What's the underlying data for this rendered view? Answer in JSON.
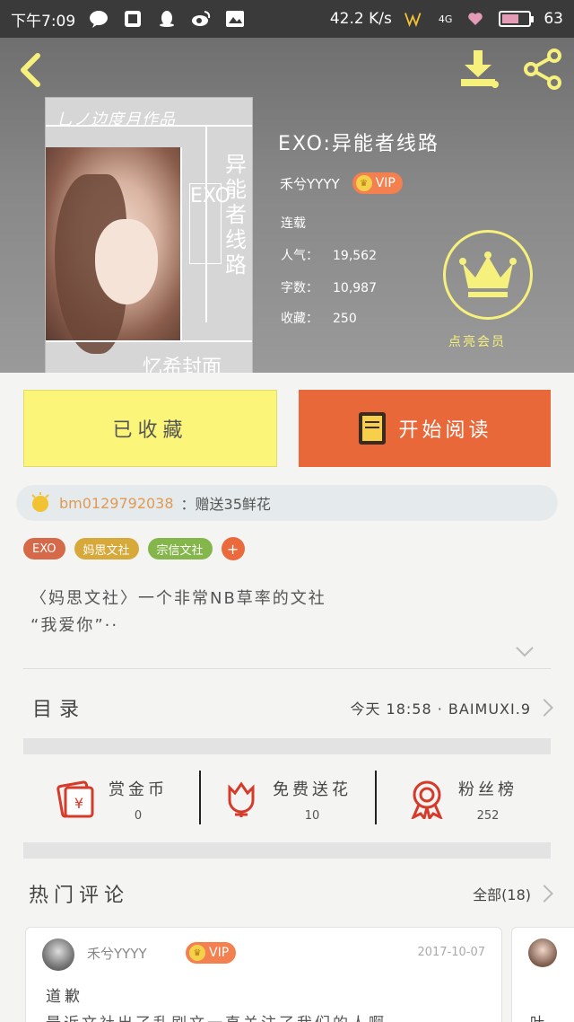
{
  "status_bar": {
    "time": "下午7:09",
    "speed": "42.2 K/s",
    "network": "4G",
    "battery": "63",
    "battery_level": 0.63
  },
  "book": {
    "cover_author": "乚ノ边度月作品",
    "cover_exo": "EXO",
    "cover_vertical_title": "异能者线路",
    "cover_bottom": "忆希封面",
    "title": "EXO:异能者线路",
    "author": "禾兮YYYY",
    "vip": "VIP",
    "status": "连载",
    "popularity_label": "人气：",
    "popularity": "19,562",
    "words_label": "字数：",
    "words": "10,987",
    "favorites_label": "收藏：",
    "favorites": "250",
    "crown_label": "点亮会员"
  },
  "actions": {
    "favorited": "已收藏",
    "start_reading": "开始阅读"
  },
  "gift": {
    "user": "bm0129792038",
    "text": "：赠送35鲜花"
  },
  "tags": [
    {
      "label": "EXO",
      "color": "#d5694a"
    },
    {
      "label": "妈思文社",
      "color": "#d7a93b"
    },
    {
      "label": "宗信文社",
      "color": "#84b64c"
    }
  ],
  "tag_add": "+",
  "description": {
    "line1": "〈妈思文社〉一个非常NB草率的文社",
    "line2": "“我爱你”··"
  },
  "toc": {
    "title": "目录",
    "update": "今天 18:58 · BAIMUXI.9"
  },
  "stats": [
    {
      "label": "赏金币",
      "value": "0",
      "icon": "red-envelope-icon"
    },
    {
      "label": "免费送花",
      "value": "10",
      "icon": "flower-icon"
    },
    {
      "label": "粉丝榜",
      "value": "252",
      "icon": "medal-icon"
    }
  ],
  "hot_comments": {
    "title": "热门评论",
    "all": "全部(18)"
  },
  "comments": [
    {
      "user": "禾兮YYYY",
      "vip": "VIP",
      "date": "2017-10-07",
      "title": "道歉",
      "body": "最近文社出了乱刷文一直关注了我们的人啊"
    },
    {
      "title": "叶"
    }
  ],
  "colors": {
    "fav_button": "#fbf67a",
    "read_button": "#e8683a",
    "accent_red": "#d63a2a",
    "crown_yellow": "#f6f07c"
  }
}
